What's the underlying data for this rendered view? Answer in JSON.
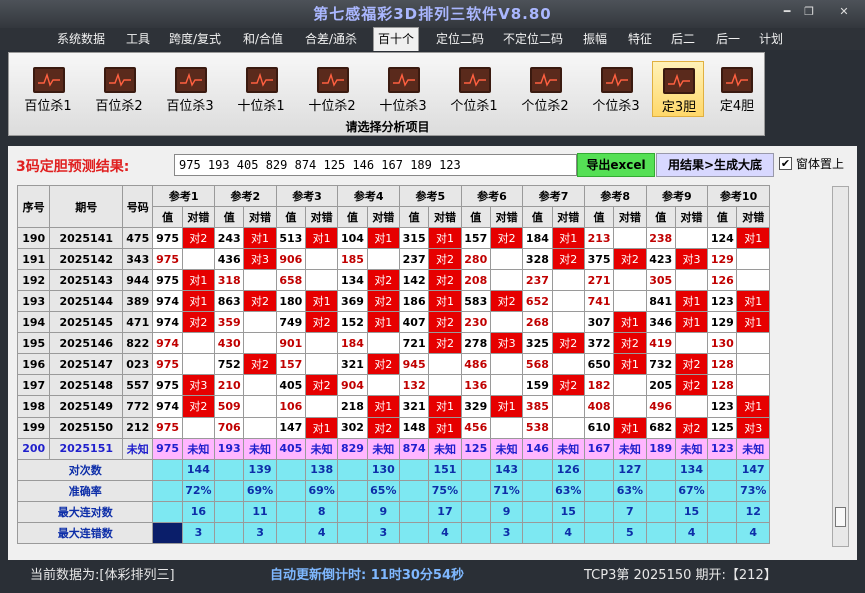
{
  "title": "第七感福彩3D排列三软件V8.80",
  "window_buttons": [
    "━",
    "❐",
    "✕"
  ],
  "menu": [
    "系统数据",
    "工具",
    "跨度/复式",
    "和/合值",
    "合差/通杀",
    "百十个",
    "定位二码",
    "不定位二码",
    "振幅",
    "特征",
    "后二",
    "后一",
    "计划"
  ],
  "menu_active": 5,
  "ribbon": {
    "buttons": [
      "百位杀1",
      "百位杀2",
      "百位杀3",
      "十位杀1",
      "十位杀2",
      "十位杀3",
      "个位杀1",
      "个位杀2",
      "个位杀3",
      "定3胆",
      "定4胆"
    ],
    "selected": 9,
    "caption": "请选择分析项目",
    "icon": "chart-line-icon"
  },
  "prediction": {
    "label": "3码定胆预测结果:",
    "value": "975 193 405 829 874 125 146 167 189 123",
    "excel_button": "导出excel",
    "gen_button": "用结果>生成大底",
    "topmost_label": "窗体置上",
    "topmost_checked": true
  },
  "table": {
    "headers": {
      "seq": "序号",
      "period": "期号",
      "number": "号码",
      "refs": [
        "参考1",
        "参考2",
        "参考3",
        "参考4",
        "参考5",
        "参考6",
        "参考7",
        "参考8",
        "参考9",
        "参考10"
      ],
      "val": "值",
      "check": "对错"
    },
    "rows": [
      {
        "seq": "190",
        "period": "2025141",
        "number": "475",
        "cells": [
          [
            "975",
            "对2"
          ],
          [
            "243",
            "对1"
          ],
          [
            "513",
            "对1"
          ],
          [
            "104",
            "对1"
          ],
          [
            "315",
            "对1"
          ],
          [
            "157",
            "对2"
          ],
          [
            "184",
            "对1"
          ],
          [
            "213",
            ""
          ],
          [
            "238",
            ""
          ],
          [
            "124",
            "对1"
          ]
        ]
      },
      {
        "seq": "191",
        "period": "2025142",
        "number": "343",
        "cells": [
          [
            "975",
            ""
          ],
          [
            "436",
            "对3"
          ],
          [
            "906",
            ""
          ],
          [
            "185",
            ""
          ],
          [
            "237",
            "对2"
          ],
          [
            "280",
            ""
          ],
          [
            "328",
            "对2"
          ],
          [
            "375",
            "对2"
          ],
          [
            "423",
            "对3"
          ],
          [
            "129",
            ""
          ]
        ]
      },
      {
        "seq": "192",
        "period": "2025143",
        "number": "944",
        "cells": [
          [
            "975",
            "对1"
          ],
          [
            "318",
            ""
          ],
          [
            "658",
            ""
          ],
          [
            "134",
            "对2"
          ],
          [
            "142",
            "对2"
          ],
          [
            "208",
            ""
          ],
          [
            "237",
            ""
          ],
          [
            "271",
            ""
          ],
          [
            "305",
            ""
          ],
          [
            "126",
            ""
          ]
        ]
      },
      {
        "seq": "193",
        "period": "2025144",
        "number": "389",
        "cells": [
          [
            "974",
            "对1"
          ],
          [
            "863",
            "对2"
          ],
          [
            "180",
            "对1"
          ],
          [
            "369",
            "对2"
          ],
          [
            "186",
            "对1"
          ],
          [
            "583",
            "对2"
          ],
          [
            "652",
            ""
          ],
          [
            "741",
            ""
          ],
          [
            "841",
            "对1"
          ],
          [
            "123",
            "对1"
          ]
        ]
      },
      {
        "seq": "194",
        "period": "2025145",
        "number": "471",
        "cells": [
          [
            "974",
            "对2"
          ],
          [
            "359",
            ""
          ],
          [
            "749",
            "对2"
          ],
          [
            "152",
            "对1"
          ],
          [
            "407",
            "对2"
          ],
          [
            "230",
            ""
          ],
          [
            "268",
            ""
          ],
          [
            "307",
            "对1"
          ],
          [
            "346",
            "对1"
          ],
          [
            "129",
            "对1"
          ]
        ]
      },
      {
        "seq": "195",
        "period": "2025146",
        "number": "822",
        "cells": [
          [
            "974",
            ""
          ],
          [
            "430",
            ""
          ],
          [
            "901",
            ""
          ],
          [
            "184",
            ""
          ],
          [
            "721",
            "对2"
          ],
          [
            "278",
            "对3"
          ],
          [
            "325",
            "对2"
          ],
          [
            "372",
            "对2"
          ],
          [
            "419",
            ""
          ],
          [
            "130",
            ""
          ]
        ]
      },
      {
        "seq": "196",
        "period": "2025147",
        "number": "023",
        "cells": [
          [
            "975",
            ""
          ],
          [
            "752",
            "对2"
          ],
          [
            "157",
            ""
          ],
          [
            "321",
            "对2"
          ],
          [
            "945",
            ""
          ],
          [
            "486",
            ""
          ],
          [
            "568",
            ""
          ],
          [
            "650",
            "对1"
          ],
          [
            "732",
            "对2"
          ],
          [
            "128",
            ""
          ]
        ]
      },
      {
        "seq": "197",
        "period": "2025148",
        "number": "557",
        "cells": [
          [
            "975",
            "对3"
          ],
          [
            "210",
            ""
          ],
          [
            "405",
            "对2"
          ],
          [
            "904",
            ""
          ],
          [
            "132",
            ""
          ],
          [
            "136",
            ""
          ],
          [
            "159",
            "对2"
          ],
          [
            "182",
            ""
          ],
          [
            "205",
            "对2"
          ],
          [
            "128",
            ""
          ]
        ]
      },
      {
        "seq": "198",
        "period": "2025149",
        "number": "772",
        "cells": [
          [
            "974",
            "对2"
          ],
          [
            "509",
            ""
          ],
          [
            "106",
            ""
          ],
          [
            "218",
            "对1"
          ],
          [
            "321",
            "对1"
          ],
          [
            "329",
            "对1"
          ],
          [
            "385",
            ""
          ],
          [
            "408",
            ""
          ],
          [
            "496",
            ""
          ],
          [
            "123",
            "对1"
          ]
        ]
      },
      {
        "seq": "199",
        "period": "2025150",
        "number": "212",
        "cells": [
          [
            "975",
            ""
          ],
          [
            "706",
            ""
          ],
          [
            "147",
            "对1"
          ],
          [
            "302",
            "对2"
          ],
          [
            "148",
            "对1"
          ],
          [
            "456",
            ""
          ],
          [
            "538",
            ""
          ],
          [
            "610",
            "对1"
          ],
          [
            "682",
            "对2"
          ],
          [
            "125",
            "对3"
          ]
        ]
      }
    ],
    "unknown_row": {
      "seq": "200",
      "period": "2025151",
      "number": "未知",
      "values": [
        "975",
        "193",
        "405",
        "829",
        "874",
        "125",
        "146",
        "167",
        "189",
        "123"
      ],
      "check": "未知"
    },
    "stats": [
      {
        "label": "对次数",
        "values": [
          "144",
          "139",
          "138",
          "130",
          "151",
          "143",
          "126",
          "127",
          "134",
          "147"
        ]
      },
      {
        "label": "准确率",
        "values": [
          "72%",
          "69%",
          "69%",
          "65%",
          "75%",
          "71%",
          "63%",
          "63%",
          "67%",
          "73%"
        ]
      },
      {
        "label": "最大连对数",
        "values": [
          "16",
          "11",
          "8",
          "9",
          "17",
          "9",
          "15",
          "7",
          "15",
          "12"
        ]
      },
      {
        "label": "最大连错数",
        "values": [
          "3",
          "3",
          "4",
          "3",
          "4",
          "3",
          "4",
          "5",
          "4",
          "4"
        ]
      }
    ]
  },
  "status": {
    "source": "当前数据为:[体彩排列三]",
    "timer": "自动更新倒计时: 11时30分54秒",
    "issue": "TCP3第 2025150 期开:【212】"
  }
}
